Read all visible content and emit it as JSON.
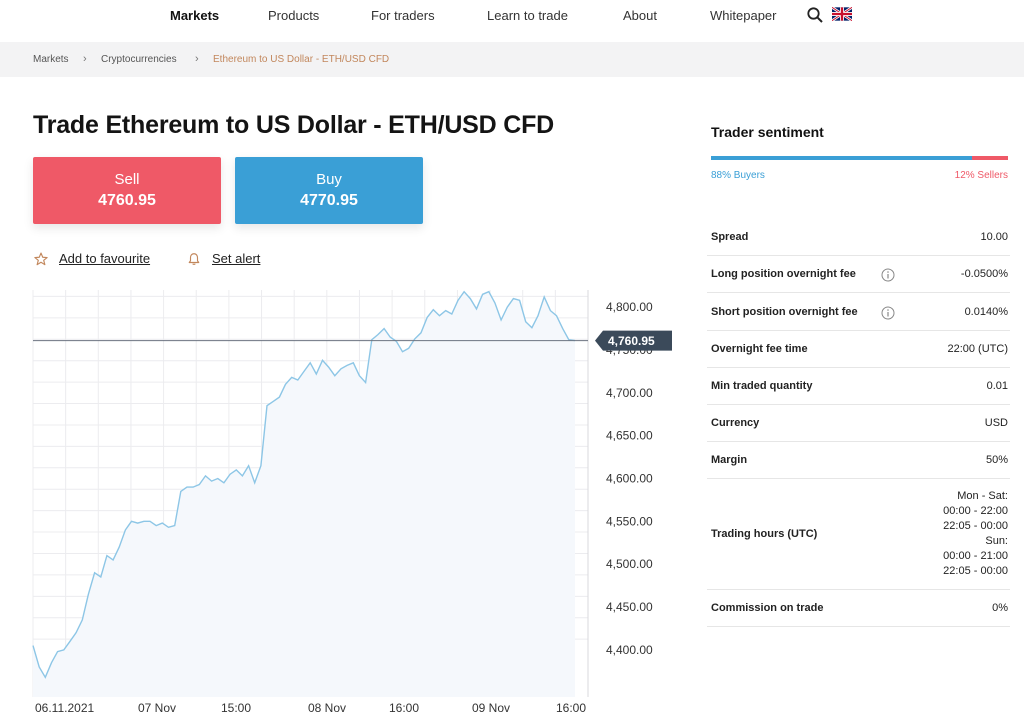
{
  "nav": {
    "items": [
      "Markets",
      "Products",
      "For traders",
      "Learn to trade",
      "About",
      "Whitepaper"
    ],
    "active": "Markets",
    "search_icon": "search-icon",
    "flag_icon": "uk-flag-icon"
  },
  "breadcrumb": [
    "Markets",
    "Cryptocurrencies",
    "Ethereum to US Dollar - ETH/USD CFD"
  ],
  "title": "Trade Ethereum to US Dollar - ETH/USD CFD",
  "sell": {
    "label": "Sell",
    "price": "4760.95"
  },
  "buy": {
    "label": "Buy",
    "price": "4770.95"
  },
  "actions": {
    "favourite": "Add to favourite",
    "alert": "Set alert"
  },
  "colors": {
    "sell": "#ef5967",
    "buy": "#3a9fd6",
    "accent": "#c2875c",
    "line": "#8dc6e6",
    "badge": "#3b4a5a"
  },
  "chart_data": {
    "type": "area",
    "current_price": "4,760.95",
    "current_value": 4760.95,
    "y_ticks": [
      "4,800.00",
      "4,750.00",
      "4,700.00",
      "4,650.00",
      "4,600.00",
      "4,550.00",
      "4,500.00",
      "4,450.00",
      "4,400.00"
    ],
    "y_tick_values": [
      4800,
      4750,
      4700,
      4650,
      4600,
      4550,
      4500,
      4450,
      4400
    ],
    "x_ticks": [
      "06.11.2021",
      "07 Nov",
      "15:00",
      "08 Nov",
      "16:00",
      "09 Nov",
      "16:00"
    ],
    "ylim": [
      4340,
      4830
    ],
    "values": [
      4405,
      4380,
      4368,
      4385,
      4398,
      4400,
      4410,
      4420,
      4435,
      4465,
      4490,
      4485,
      4510,
      4505,
      4520,
      4540,
      4550,
      4548,
      4550,
      4550,
      4545,
      4548,
      4543,
      4545,
      4585,
      4590,
      4590,
      4593,
      4603,
      4597,
      4600,
      4595,
      4605,
      4610,
      4603,
      4615,
      4595,
      4615,
      4685,
      4690,
      4695,
      4710,
      4718,
      4715,
      4725,
      4735,
      4722,
      4738,
      4730,
      4720,
      4728,
      4732,
      4735,
      4720,
      4712,
      4762,
      4768,
      4775,
      4765,
      4760,
      4748,
      4752,
      4763,
      4770,
      4788,
      4797,
      4790,
      4796,
      4792,
      4808,
      4818,
      4810,
      4798,
      4815,
      4818,
      4805,
      4785,
      4800,
      4810,
      4808,
      4783,
      4776,
      4790,
      4812,
      4796,
      4790,
      4775,
      4762,
      4761
    ]
  },
  "sentiment": {
    "title": "Trader sentiment",
    "buyers_pct": 88,
    "buyers_label": "88% Buyers",
    "sellers_label": "12% Sellers"
  },
  "info": [
    {
      "k": "Spread",
      "v": "10.00"
    },
    {
      "k": "Long position overnight fee",
      "v": "-0.0500%",
      "info": true
    },
    {
      "k": "Short position overnight fee",
      "v": "0.0140%",
      "info": true
    },
    {
      "k": "Overnight fee time",
      "v": "22:00 (UTC)"
    },
    {
      "k": "Min traded quantity",
      "v": "0.01"
    },
    {
      "k": "Currency",
      "v": "USD"
    },
    {
      "k": "Margin",
      "v": "50%"
    },
    {
      "k": "Trading hours (UTC)",
      "v": [
        "Mon - Sat:",
        "00:00 - 22:00",
        "22:05 - 00:00",
        "Sun:",
        "00:00 - 21:00",
        "22:05 - 00:00"
      ]
    },
    {
      "k": "Commission on trade",
      "v": "0%"
    }
  ]
}
